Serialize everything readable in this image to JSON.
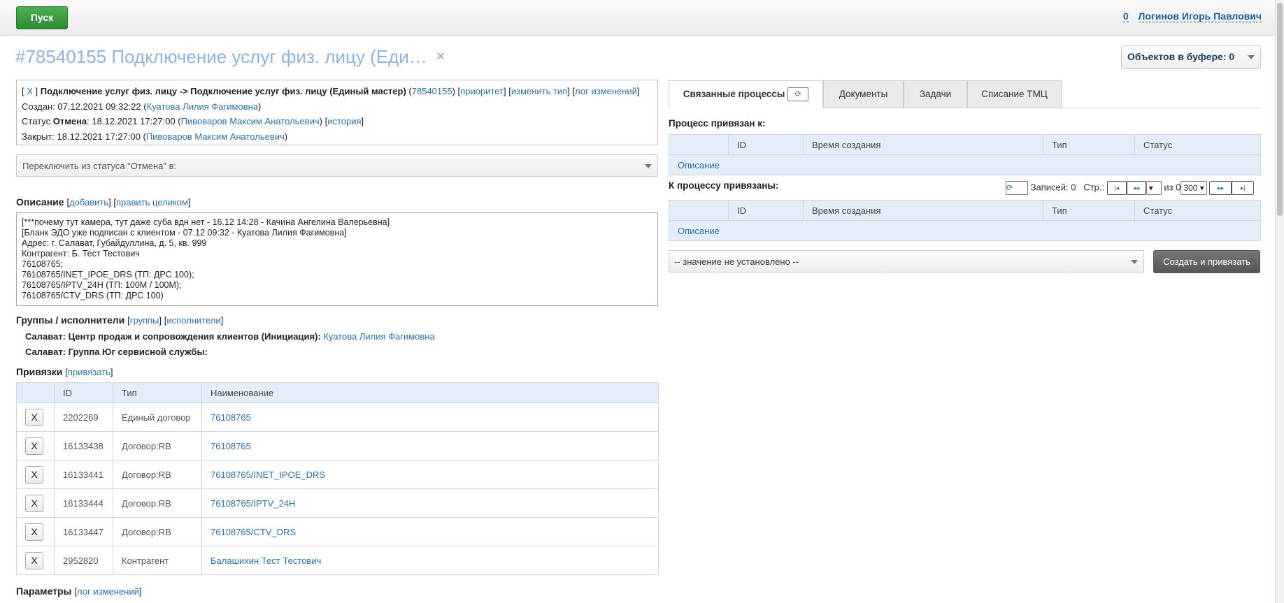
{
  "topbar": {
    "start_label": "Пуск",
    "buffer_count": "0",
    "user_name": "Логинов Игорь Павлович"
  },
  "header": {
    "title": "#78540155 Подключение услуг физ. лицу (Еди…",
    "close_glyph": "×",
    "buffer_label": "Объектов в буфере:",
    "buffer_value": "0"
  },
  "info": {
    "x_link": "X",
    "process_path": "Подключение услуг физ. лицу -> Подключение услуг физ. лицу (Единый мастер)",
    "id_link": "78540155",
    "priority_link": "приоритет",
    "change_type_link": "изменить тип",
    "changes_log_link": "лог изменений",
    "created_label": "Создан:",
    "created_value": "07.12.2021 09:32:22",
    "created_by": "Куатова Лилия Фагимовна",
    "status_label": "Статус",
    "status_value": "Отмена",
    "status_time": "18.12.2021 17:27:00",
    "status_by": "Пивоваров Максим Анатольевич",
    "history_link": "история",
    "closed_label": "Закрыт:",
    "closed_value": "18.12.2021 17:27:00",
    "closed_by": "Пивоваров Максим Анатольевич"
  },
  "switch_status": "Переключить из статуса \"Отмена\" в:",
  "description": {
    "heading": "Описание",
    "add_link": "добавить",
    "edit_link": "править целиком",
    "text": "[***почему тут камера, тут даже суба вдн нет - 16.12 14:28 - Качина Ангелина Валерьевна]\n[Бланк ЭДО уже подписан с клиентом - 07.12 09:32 - Куатова Лилия Фагимовна]\nАдрес: г. Салават, Губайдуллина, д. 5, кв. 999\nКонтрагент: Б. Тест Тестович\n76108765;\n76108765/INET_IPOE_DRS (ТП: ДРС 100);\n76108765/IPTV_24H (ТП: 100М / 100М);\n76108765/CTV_DRS (ТП: ДРС 100)"
  },
  "groups": {
    "heading": "Группы / исполнители",
    "groups_link": "группы",
    "executors_link": "исполнители",
    "line1_label": "Салават: Центр продаж и сопровождения клиентов (Инициация):",
    "line1_person": "Куатова Лилия Фагимовна",
    "line2_label": "Салават: Группа Юг сервисной службы:"
  },
  "bindings": {
    "heading": "Привязки",
    "bind_link": "привязать",
    "columns": [
      "ID",
      "Тип",
      "Наименование"
    ],
    "remove_label": "X",
    "rows": [
      {
        "id": "2202269",
        "type": "Единый договор",
        "name": "76108765"
      },
      {
        "id": "16133438",
        "type": "Договор:RB",
        "name": "76108765"
      },
      {
        "id": "16133441",
        "type": "Договор:RB",
        "name": "76108765/INET_IPOE_DRS"
      },
      {
        "id": "16133444",
        "type": "Договор:RB",
        "name": "76108765/IPTV_24H"
      },
      {
        "id": "16133447",
        "type": "Договор:RB",
        "name": "76108765/CTV_DRS"
      },
      {
        "id": "2952820",
        "type": "Контрагент",
        "name": "Балашихин Тест Тестович"
      }
    ]
  },
  "params": {
    "heading": "Параметры",
    "log_link": "лог изменений"
  },
  "tabs": [
    "Связанные процессы",
    "Документы",
    "Задачи",
    "Списание ТМЦ"
  ],
  "linked": {
    "bound_to_heading": "Процесс привязан к:",
    "bound_heading": "К процессу привязаны:",
    "columns": [
      "ID",
      "Время создания",
      "Тип",
      "Статус"
    ],
    "desc_label": "Описание",
    "records_label": "Записей: 0",
    "page_label": "Стр.:",
    "of_label": "из 0",
    "page_size": "300",
    "select_value": "-- значение не установлено --",
    "create_button": "Создать и привязать"
  },
  "icons": {
    "refresh": "refresh-icon",
    "first": "first-page-icon",
    "prev": "prev-page-icon",
    "next": "next-page-icon",
    "last": "last-page-icon"
  }
}
